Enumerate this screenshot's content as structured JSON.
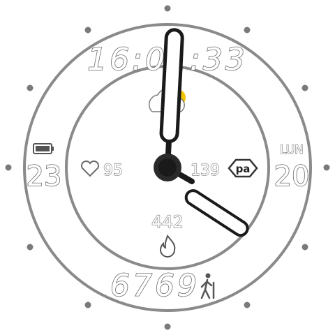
{
  "time": {
    "text": "16:01:33"
  },
  "battery": {
    "value": "23",
    "icon": "battery-icon"
  },
  "heart_rate": {
    "value": "95",
    "icon": "heart-icon"
  },
  "pressure": {
    "value": "139",
    "unit": "pa"
  },
  "date": {
    "weekday": "LUN",
    "day": "20"
  },
  "calories": {
    "value": "442",
    "icon": "flame-icon"
  },
  "steps": {
    "value": "6769",
    "icon": "walking-person-icon"
  },
  "weather": {
    "icon": "partly-sunny-icon"
  },
  "colors": {
    "ring": "#8a8a8a",
    "dots": "#7a7a7a",
    "hand": "#1a1a1a",
    "sun": "#f2c300"
  }
}
